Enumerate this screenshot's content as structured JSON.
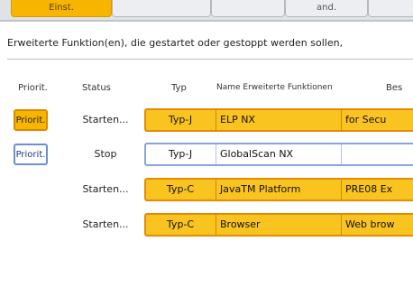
{
  "tabs": [
    {
      "label": "Einst."
    },
    {
      "label": ""
    },
    {
      "label": ""
    },
    {
      "label": "and."
    },
    {
      "label": ""
    }
  ],
  "message": "Erweiterte Funktion(en), die gestartet oder gestoppt werden sollen,",
  "columns": {
    "priority": "Priorit.",
    "status": "Status",
    "type": "Typ",
    "name": "Name Erweiterte Funktionen",
    "description": "Bes"
  },
  "rows": [
    {
      "priority": "Priorit.",
      "status": "Starten...",
      "type": "Typ-J",
      "name": "ELP NX",
      "description": "for Secu"
    },
    {
      "priority": "Priorit.",
      "status": "Stop",
      "type": "Typ-J",
      "name": "GlobalScan NX",
      "description": ""
    },
    {
      "priority": "",
      "status": "Starten...",
      "type": "Typ-C",
      "name": "JavaTM Platform",
      "description": "PRE08 Ex"
    },
    {
      "priority": "",
      "status": "Starten...",
      "type": "Typ-C",
      "name": "Browser",
      "description": "Web brow"
    }
  ],
  "colors": {
    "active": "#f9c320",
    "active_border": "#e48b00",
    "inactive_border": "#8aa3d8",
    "button_border": "#6f8fd0"
  }
}
